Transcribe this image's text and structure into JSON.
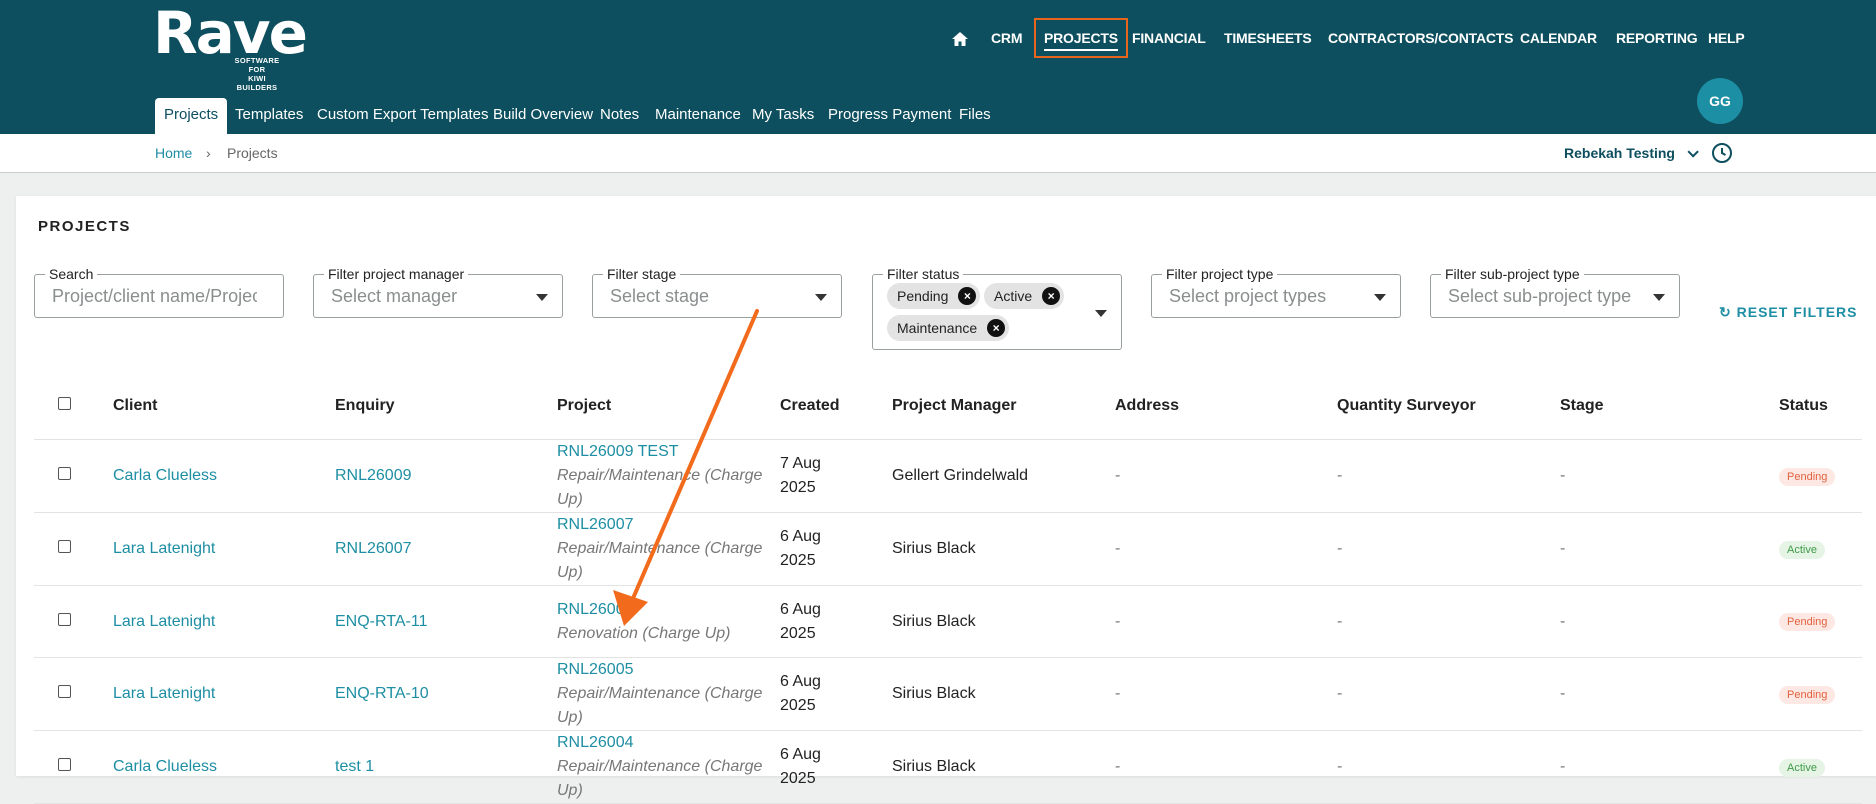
{
  "brand": {
    "name": "Rave",
    "tagline_1": "SOFTWARE FOR",
    "tagline_2": "KIWI BUILDERS"
  },
  "top_nav": [
    "CRM",
    "PROJECTS",
    "FINANCIAL",
    "TIMESHEETS",
    "CONTRACTORS/CONTACTS",
    "CALENDAR",
    "REPORTING",
    "HELP"
  ],
  "user": {
    "initials": "GG",
    "account": "Rebekah Testing"
  },
  "sub_nav": [
    "Projects",
    "Templates",
    "Custom Export Templates",
    "Build Overview",
    "Notes",
    "Maintenance",
    "My Tasks",
    "Progress Payment",
    "Files"
  ],
  "breadcrumb": {
    "home": "Home",
    "sep": "›",
    "current": "Projects"
  },
  "page_title": "PROJECTS",
  "filters": {
    "search": {
      "label": "Search",
      "placeholder": "Project/client name/Project"
    },
    "manager": {
      "label": "Filter project manager",
      "placeholder": "Select manager"
    },
    "stage": {
      "label": "Filter stage",
      "placeholder": "Select stage"
    },
    "status": {
      "label": "Filter status",
      "chips": [
        "Pending",
        "Active",
        "Maintenance"
      ]
    },
    "type": {
      "label": "Filter project type",
      "placeholder": "Select project types"
    },
    "subtype": {
      "label": "Filter sub-project type",
      "placeholder": "Select sub-project type"
    },
    "reset": "RESET FILTERS"
  },
  "table": {
    "headers": [
      "Client",
      "Enquiry",
      "Project",
      "Created",
      "Project Manager",
      "Address",
      "Quantity Surveyor",
      "Stage",
      "Status"
    ],
    "rows": [
      {
        "client": "Carla Clueless",
        "enquiry": "RNL26009",
        "project": "RNL26009 TEST",
        "project_sub": "Repair/Maintenance (Charge Up)",
        "created_1": "7 Aug",
        "created_2": "2025",
        "manager": "Gellert Grindelwald",
        "address": "-",
        "qs": "-",
        "stage": "-",
        "status": "Pending"
      },
      {
        "client": "Lara Latenight",
        "enquiry": "RNL26007",
        "project": "RNL26007",
        "project_sub": "Repair/Maintenance (Charge Up)",
        "created_1": "6 Aug",
        "created_2": "2025",
        "manager": "Sirius Black",
        "address": "-",
        "qs": "-",
        "stage": "-",
        "status": "Active"
      },
      {
        "client": "Lara Latenight",
        "enquiry": "ENQ-RTA-11",
        "project": "RNL26006",
        "project_sub": "Renovation (Charge Up)",
        "created_1": "6 Aug",
        "created_2": "2025",
        "manager": "Sirius Black",
        "address": "-",
        "qs": "-",
        "stage": "-",
        "status": "Pending"
      },
      {
        "client": "Lara Latenight",
        "enquiry": "ENQ-RTA-10",
        "project": "RNL26005",
        "project_sub": "Repair/Maintenance (Charge Up)",
        "created_1": "6 Aug",
        "created_2": "2025",
        "manager": "Sirius Black",
        "address": "-",
        "qs": "-",
        "stage": "-",
        "status": "Pending"
      },
      {
        "client": "Carla Clueless",
        "enquiry": "test 1",
        "project": "RNL26004",
        "project_sub": "Repair/Maintenance (Charge Up)",
        "created_1": "6 Aug",
        "created_2": "2025",
        "manager": "Sirius Black",
        "address": "-",
        "qs": "-",
        "stage": "-",
        "status": "Active"
      }
    ]
  },
  "colors": {
    "header_bg": "#0d4f5e",
    "accent": "#1d8ea3",
    "highlight": "#e8651e"
  }
}
